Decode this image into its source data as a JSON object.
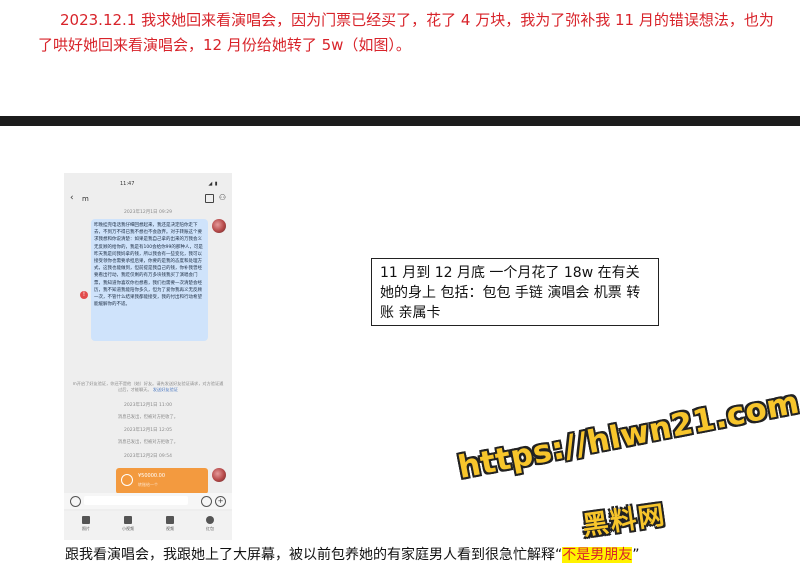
{
  "top_paragraph": "2023.12.1 我求她回来看演唱会，因为门票已经买了，花了 4 万块，我为了弥补我 11 月的错误想法，也为了哄好她回来看演唱会，12 月份给她转了 5w（如图）。",
  "phone": {
    "status_time": "11:47",
    "status_icons": "◢ ▮",
    "contact_name": "m",
    "timestamp_1": "2023年12月1日 09:29",
    "message": "昨晚挂完电话我仔细回想起来，我还是决定陪你走下去，不到万不得已我不想也不会放弃。对于转账这个要求我想和你说清楚：如果是我自己拿的出来的万我会义无反顾的给你的，我是有100会给你99的那种人，可是昨天我是问我妈拿的钱，所以我会有一些变化，我可以接受领你也需要承担后果，你要的是我的态度和处理方式，这我也能做到，但前提是我自己的钱，你补我曾经要看出行动，我贬仅剩的有万多块钱我买了演唱会门票，我知道你喜欢你也想看，我们也需要一次清楚会经历，我不知道我能陪你多久，但为了爱你我再义无反顾一次，不管什么结果我都能接受，我的付出和行动希望能缓解你的不适。",
    "verify_note": "m开启了好友验证，你还不是他（她）好友。请先发送好友验证请求，对方验证通过后，才能聊天。",
    "verify_link": "发送好友验证",
    "timestamp_2": "2023年12月1日 11:00",
    "sys_1": "消息已发出，但被对方拒收了。",
    "timestamp_3": "2023年12月1日 12:05",
    "sys_2": "消息已发出，但被对方拒收了。",
    "timestamp_4": "2023年12月2日 09:54",
    "transfer_amount": "¥50000.00",
    "transfer_status": "转账给一个",
    "tools": [
      "照片",
      "小视频",
      "视频",
      "红包"
    ]
  },
  "box_note": "11 月到 12 月底   一个月花了 18w 在有关她的身上    包括：包包   手链   演唱会   机票    转账   亲属卡",
  "watermark": {
    "url": "https://hlwn21.com",
    "name": "黑料网"
  },
  "caption": {
    "text": "跟我看演唱会，我跟她上了大屏幕，被以前包养她的有家庭男人看到很急忙解释“",
    "highlight": "不是男朋友",
    "end": "”"
  },
  "colors": {
    "red_text": "#d8232a",
    "separator": "#1c1c1c",
    "highlight": "#fff200",
    "bubble": "#cfe3fb",
    "transfer": "#f39a3f",
    "watermark": "#f7c52b"
  }
}
